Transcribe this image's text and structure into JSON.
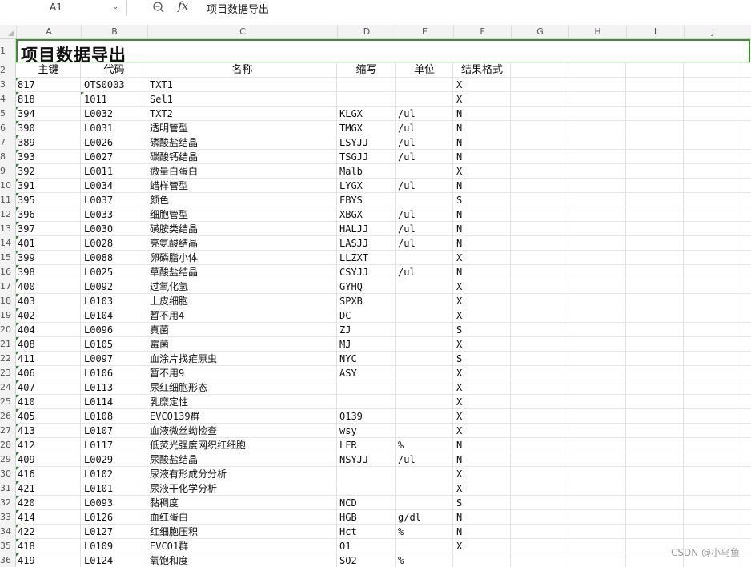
{
  "name_box": "A1",
  "formula_content": "项目数据导出",
  "columns": [
    "A",
    "B",
    "C",
    "D",
    "E",
    "F",
    "G",
    "H",
    "I",
    "J"
  ],
  "title": "项目数据导出",
  "headers": [
    "主键",
    "代码",
    "名称",
    "缩写",
    "单位",
    "结果格式"
  ],
  "row_numbers": [
    "1",
    "2",
    "3",
    "4",
    "5",
    "6",
    "7",
    "8",
    "9",
    "10",
    "11",
    "12",
    "13",
    "14",
    "15",
    "16",
    "17",
    "18",
    "19",
    "20",
    "21",
    "22",
    "23",
    "24",
    "25",
    "26",
    "27",
    "28",
    "29",
    "30",
    "31",
    "32",
    "33",
    "34",
    "35",
    "36"
  ],
  "rows": [
    [
      "817",
      "OTS0003",
      "TXT1",
      "",
      "",
      "X"
    ],
    [
      "818",
      "1011",
      "Sel1",
      "",
      "",
      "X"
    ],
    [
      "394",
      "L0032",
      "TXT2",
      "KLGX",
      "/ul",
      "N"
    ],
    [
      "390",
      "L0031",
      "透明管型",
      "TMGX",
      "/ul",
      "N"
    ],
    [
      "389",
      "L0026",
      "磷酸盐结晶",
      "LSYJJ",
      "/ul",
      "N"
    ],
    [
      "393",
      "L0027",
      "碳酸钙结晶",
      "TSGJJ",
      "/ul",
      "N"
    ],
    [
      "392",
      "L0011",
      "微量白蛋白",
      "Malb",
      "",
      "X"
    ],
    [
      "391",
      "L0034",
      "蜡样管型",
      "LYGX",
      "/ul",
      "N"
    ],
    [
      "395",
      "L0037",
      "颜色",
      "FBYS",
      "",
      "S"
    ],
    [
      "396",
      "L0033",
      "细胞管型",
      "XBGX",
      "/ul",
      "N"
    ],
    [
      "397",
      "L0030",
      "磺胺类结晶",
      "HALJJ",
      "/ul",
      "N"
    ],
    [
      "401",
      "L0028",
      "亮氨酸结晶",
      "LASJJ",
      "/ul",
      "N"
    ],
    [
      "399",
      "L0088",
      "卵磷脂小体",
      "LLZXT",
      "",
      "X"
    ],
    [
      "398",
      "L0025",
      "草酸盐结晶",
      "CSYJJ",
      "/ul",
      "N"
    ],
    [
      "400",
      "L0092",
      "过氧化氢",
      "GYHQ",
      "",
      "X"
    ],
    [
      "403",
      "L0103",
      "上皮细胞",
      "SPXB",
      "",
      "X"
    ],
    [
      "402",
      "L0104",
      "暂不用4",
      "DC",
      "",
      "X"
    ],
    [
      "404",
      "L0096",
      "真菌",
      "ZJ",
      "",
      "S"
    ],
    [
      "408",
      "L0105",
      "霉菌",
      "MJ",
      "",
      "X"
    ],
    [
      "411",
      "L0097",
      "血涂片找疟原虫",
      "NYC",
      "",
      "S"
    ],
    [
      "406",
      "L0106",
      "暂不用9",
      "ASY",
      "",
      "X"
    ],
    [
      "407",
      "L0113",
      "尿红细胞形态",
      "",
      "",
      "X"
    ],
    [
      "410",
      "L0114",
      "乳糜定性",
      "",
      "",
      "X"
    ],
    [
      "405",
      "L0108",
      "EVCO139群",
      "O139",
      "",
      "X"
    ],
    [
      "413",
      "L0107",
      "血液微丝蚴检查",
      "wsy",
      "",
      "X"
    ],
    [
      "412",
      "L0117",
      "低荧光强度网织红细胞",
      "LFR",
      "%",
      "N"
    ],
    [
      "409",
      "L0029",
      "尿酸盐结晶",
      "NSYJJ",
      "/ul",
      "N"
    ],
    [
      "416",
      "L0102",
      "尿液有形成分分析",
      "",
      "",
      "X"
    ],
    [
      "421",
      "L0101",
      "尿液干化学分析",
      "",
      "",
      "X"
    ],
    [
      "420",
      "L0093",
      "黏稠度",
      "NCD",
      "",
      "S"
    ],
    [
      "414",
      "L0126",
      "血红蛋白",
      "HGB",
      "g/dl",
      "N"
    ],
    [
      "422",
      "L0127",
      "红细胞压积",
      "Hct",
      "%",
      "N"
    ],
    [
      "418",
      "L0109",
      "EVCO1群",
      "O1",
      "",
      "X"
    ],
    [
      "419",
      "L0124",
      "氧饱和度",
      "SO2",
      "%",
      ""
    ]
  ],
  "watermark": "CSDN @小乌鱼",
  "colors": {
    "accent": "#3b8f2f",
    "flag": "#2e8b2e"
  }
}
